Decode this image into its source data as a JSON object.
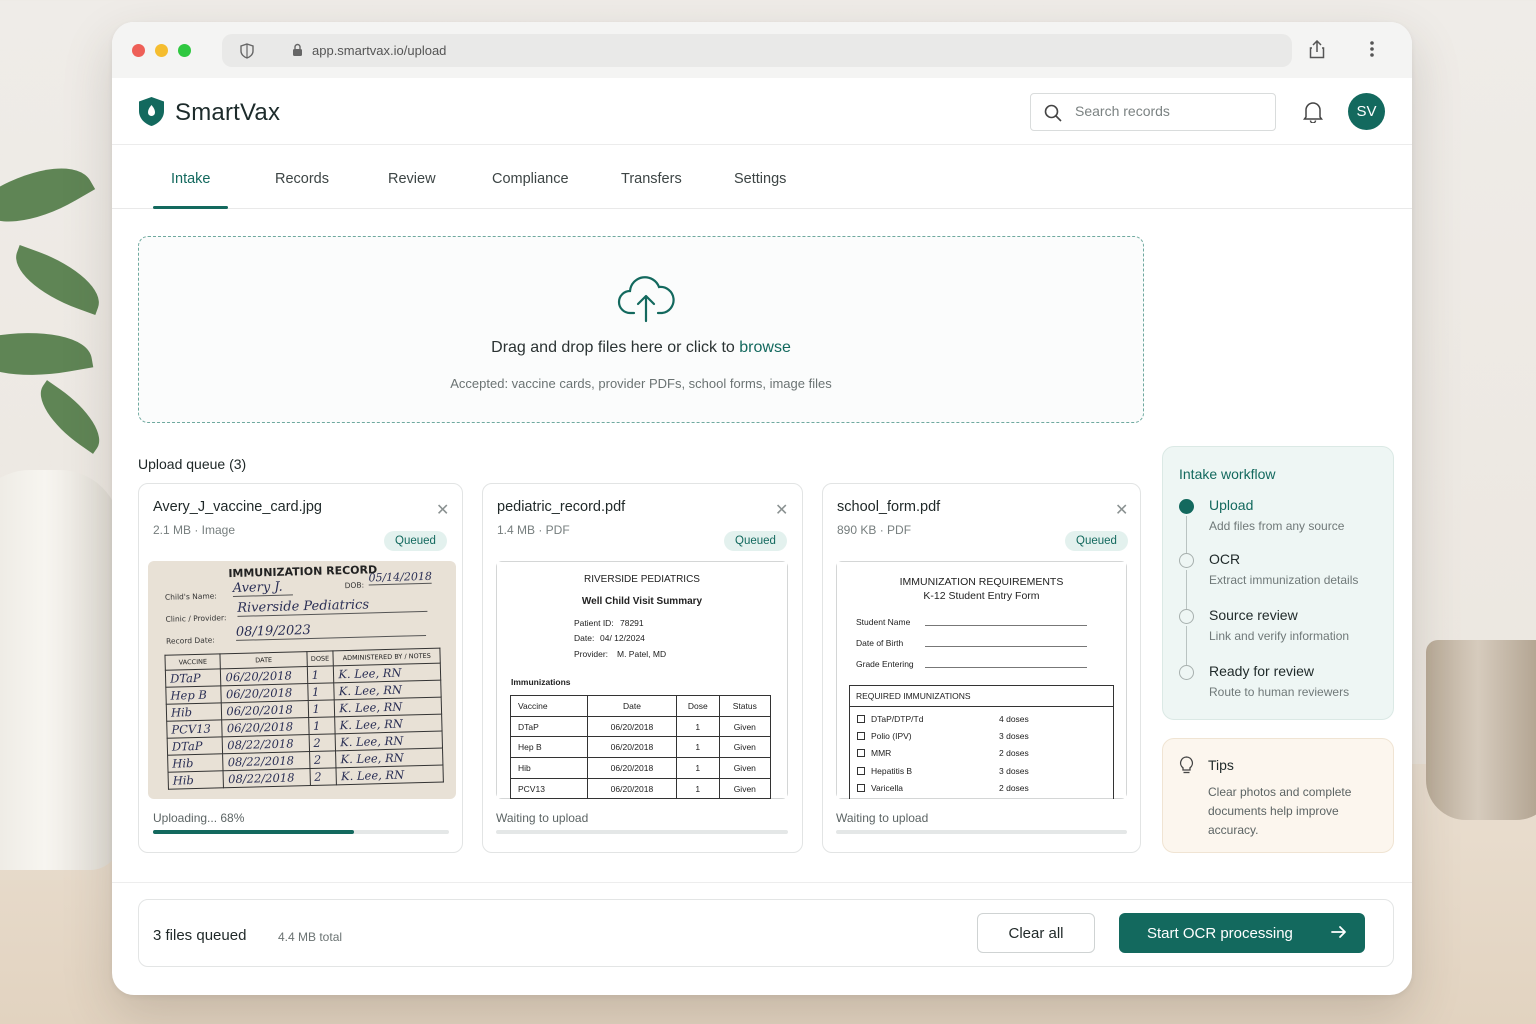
{
  "browser": {
    "url": "app.smartvax.io/upload"
  },
  "app": {
    "brand": "SmartVax",
    "search_placeholder": "Search records",
    "avatar_initials": "SV",
    "accent_color": "#13695e"
  },
  "tabs": [
    {
      "label": "Intake",
      "active": true
    },
    {
      "label": "Records"
    },
    {
      "label": "Review"
    },
    {
      "label": "Compliance"
    },
    {
      "label": "Transfers"
    },
    {
      "label": "Settings"
    }
  ],
  "dropzone": {
    "title_prefix": "Drag and drop files here or click to",
    "browse_link": "browse",
    "subtitle": "Accepted: vaccine cards, provider PDFs, school forms, image files"
  },
  "queue": {
    "title": "Upload queue (3)",
    "files": [
      {
        "name": "Avery_J_vaccine_card.jpg",
        "meta": "2.1 MB · Image",
        "badge": "Queued",
        "status": "Uploading... 68%",
        "progress": 0.68,
        "preview": {
          "title": "IMMUNIZATION RECORD",
          "child_label": "Child's Name:",
          "child_value": "Avery J.",
          "dob_label": "DOB:",
          "dob_value": "05/14/2018",
          "clinic_label": "Clinic / Provider:",
          "clinic_value": "Riverside Pediatrics",
          "record_label": "Record Date:",
          "record_value": "08/19/2023",
          "headers": [
            "VACCINE",
            "DATE",
            "DOSE",
            "ADMINISTERED BY / NOTES"
          ],
          "rows": [
            [
              "DTaP",
              "06/20/2018",
              "1",
              "K. Lee, RN"
            ],
            [
              "Hep B",
              "06/20/2018",
              "1",
              "K. Lee, RN"
            ],
            [
              "Hib",
              "06/20/2018",
              "1",
              "K. Lee, RN"
            ],
            [
              "PCV13",
              "06/20/2018",
              "1",
              "K. Lee, RN"
            ],
            [
              "DTaP",
              "08/22/2018",
              "2",
              "K. Lee, RN"
            ],
            [
              "Hib",
              "08/22/2018",
              "2",
              "K. Lee, RN"
            ],
            [
              "Hib",
              "08/22/2018",
              "2",
              "K. Lee, RN"
            ]
          ]
        }
      },
      {
        "name": "pediatric_record.pdf",
        "meta": "1.4 MB · PDF",
        "badge": "Queued",
        "status": "Waiting to upload",
        "progress": 0,
        "preview": {
          "org": "RIVERSIDE PEDIATRICS",
          "title": "Well Child Visit Summary",
          "patient_label": "Patient ID:",
          "patient_value": "78291",
          "date_label": "Date:",
          "date_value": "04/ 12/2024",
          "provider_label": "Provider:",
          "provider_value": "M. Patel, MD",
          "section": "Immunizations",
          "headers": [
            "Vaccine",
            "Date",
            "Dose",
            "Status"
          ],
          "rows": [
            [
              "DTaP",
              "06/20/2018",
              "1",
              "Given"
            ],
            [
              "Hep B",
              "06/20/2018",
              "1",
              "Given"
            ],
            [
              "Hib",
              "06/20/2018",
              "1",
              "Given"
            ],
            [
              "PCV13",
              "06/20/2018",
              "1",
              "Given"
            ]
          ]
        }
      },
      {
        "name": "school_form.pdf",
        "meta": "890 KB · PDF",
        "badge": "Queued",
        "status": "Waiting to upload",
        "progress": 0,
        "preview": {
          "title": "IMMUNIZATION REQUIREMENTS",
          "subtitle": "K-12 Student Entry Form",
          "fields": [
            "Student Name",
            "Date of Birth",
            "Grade Entering"
          ],
          "section": "REQUIRED IMMUNIZATIONS",
          "items": [
            {
              "name": "DTaP/DTP/Td",
              "doses": "4 doses"
            },
            {
              "name": "Polio (IPV)",
              "doses": "3 doses"
            },
            {
              "name": "MMR",
              "doses": "2 doses"
            },
            {
              "name": "Hepatitis B",
              "doses": "3 doses"
            },
            {
              "name": "Varicella",
              "doses": "2 doses"
            }
          ]
        }
      }
    ]
  },
  "workflow": {
    "title": "Intake workflow",
    "steps": [
      {
        "title": "Upload",
        "desc": "Add files from any source",
        "active": true
      },
      {
        "title": "OCR",
        "desc": "Extract immunization details"
      },
      {
        "title": "Source review",
        "desc": "Link and verify information"
      },
      {
        "title": "Ready for review",
        "desc": "Route to human reviewers"
      }
    ]
  },
  "tips": {
    "title": "Tips",
    "body": "Clear photos and complete documents help improve accuracy."
  },
  "footer": {
    "files_queued": "3 files queued",
    "total": "4.4 MB total",
    "clear_label": "Clear all",
    "start_label": "Start OCR processing"
  }
}
